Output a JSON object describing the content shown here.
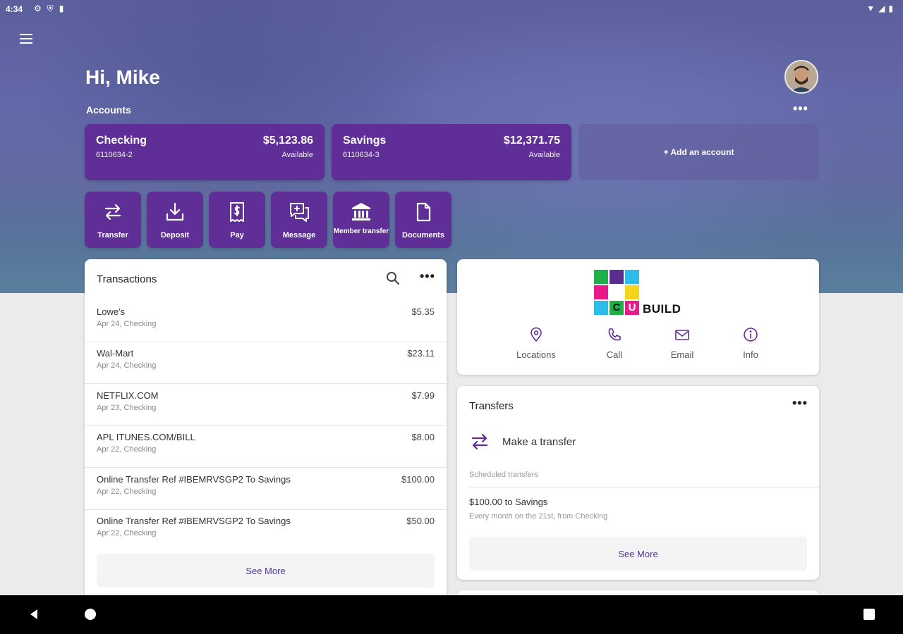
{
  "status": {
    "time": "4:34",
    "icons_left": [
      "gear-icon",
      "shield-icon",
      "sd-card-icon"
    ],
    "icons_right": [
      "wifi-icon",
      "signal-icon",
      "battery-icon"
    ]
  },
  "header": {
    "greeting": "Hi, Mike",
    "accounts_label": "Accounts",
    "more_label": "•••"
  },
  "accounts": [
    {
      "name": "Checking",
      "number": "6110634-2",
      "balance": "$5,123.86",
      "status": "Available"
    },
    {
      "name": "Savings",
      "number": "6110634-3",
      "balance": "$12,371.75",
      "status": "Available"
    }
  ],
  "add_account_label": "+ Add an account",
  "actions": [
    {
      "label": "Transfer",
      "icon": "transfer-icon"
    },
    {
      "label": "Deposit",
      "icon": "deposit-icon"
    },
    {
      "label": "Pay",
      "icon": "pay-icon"
    },
    {
      "label": "Message",
      "icon": "message-icon"
    },
    {
      "label": "Member transfer",
      "icon": "bank-icon"
    },
    {
      "label": "Documents",
      "icon": "document-icon"
    }
  ],
  "transactions": {
    "title": "Transactions",
    "more_label": "•••",
    "items": [
      {
        "name": "Lowe's",
        "sub": "Apr 24, Checking",
        "amount": "$5.35"
      },
      {
        "name": "Wal-Mart",
        "sub": "Apr 24, Checking",
        "amount": "$23.11"
      },
      {
        "name": "NETFLIX.COM",
        "sub": "Apr 23, Checking",
        "amount": "$7.99"
      },
      {
        "name": "APL ITUNES.COM/BILL",
        "sub": "Apr 22, Checking",
        "amount": "$8.00"
      },
      {
        "name": "Online Transfer Ref #IBEMRVSGP2 To Savings",
        "sub": "Apr 22, Checking",
        "amount": "$100.00"
      },
      {
        "name": "Online Transfer Ref #IBEMRVSGP2 To Savings",
        "sub": "Apr 22, Checking",
        "amount": "$50.00"
      }
    ],
    "see_more": "See More"
  },
  "brand": {
    "logo_text": "BUILD",
    "logo_letters": [
      "C",
      "U"
    ],
    "contacts": [
      {
        "label": "Locations",
        "icon": "location-pin-icon"
      },
      {
        "label": "Call",
        "icon": "phone-icon"
      },
      {
        "label": "Email",
        "icon": "email-icon"
      },
      {
        "label": "Info",
        "icon": "info-icon"
      }
    ],
    "colors": {
      "green": "#1fb04a",
      "purple": "#5b2d90",
      "cyan": "#2bbde8",
      "magenta": "#e8198b",
      "yellow": "#f7d31b"
    }
  },
  "transfers": {
    "title": "Transfers",
    "more_label": "•••",
    "make_transfer": "Make a transfer",
    "scheduled_label": "Scheduled transfers",
    "scheduled": [
      {
        "title": "$100.00 to Savings",
        "sub": "Every month on the 21st, from Checking"
      }
    ],
    "see_more": "See More"
  },
  "theme": {
    "accent": "#5f2f97",
    "link": "#4c3a8d"
  }
}
